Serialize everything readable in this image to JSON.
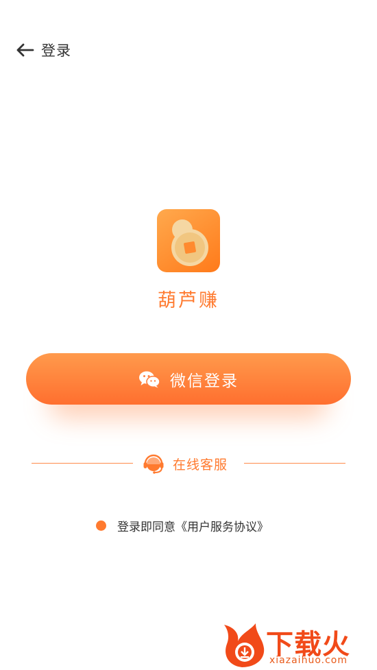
{
  "header": {
    "title": "登录"
  },
  "app": {
    "name": "葫芦赚"
  },
  "login": {
    "wechat_label": "微信登录"
  },
  "service": {
    "label": "在线客服"
  },
  "agreement": {
    "prefix": "登录即同意",
    "link": "《用户服务协议》"
  },
  "watermark": {
    "text": "下载火",
    "url": "xiazaihuo.com"
  },
  "colors": {
    "accent": "#ff7a2f",
    "button_top": "#ff9a4c",
    "button_bottom": "#ff6f2f",
    "text": "#333333"
  },
  "icons": [
    "arrow-left-icon",
    "gourd-coin-icon",
    "wechat-icon",
    "headset-icon",
    "flame-logo-icon"
  ]
}
